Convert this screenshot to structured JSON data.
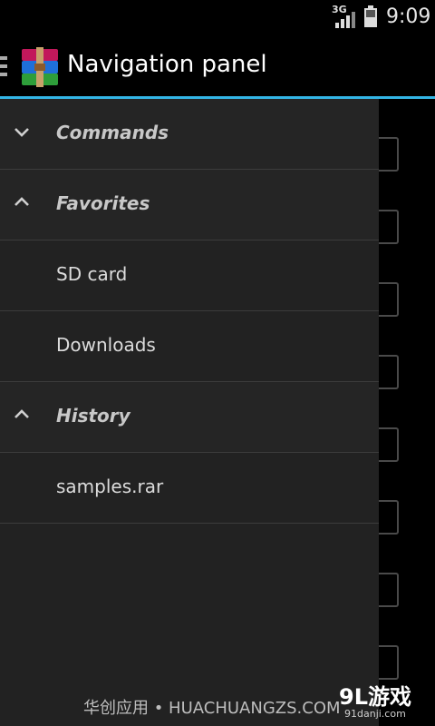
{
  "status": {
    "network": "3G",
    "time": "9:09"
  },
  "action_bar": {
    "title": "Navigation panel"
  },
  "drawer": {
    "rows": [
      {
        "type": "group",
        "label": "Commands",
        "icon": "chevron-down-icon"
      },
      {
        "type": "group",
        "label": "Favorites",
        "icon": "chevron-up-icon"
      },
      {
        "type": "item",
        "label": "SD card"
      },
      {
        "type": "item",
        "label": "Downloads"
      },
      {
        "type": "group",
        "label": "History",
        "icon": "chevron-up-icon"
      },
      {
        "type": "item",
        "label": "samples.rar"
      }
    ]
  },
  "footer": {
    "watermark": "华创应用 • HUACHUANGZS.COM",
    "badge": "9L游戏",
    "badge_site": "91danji.com"
  },
  "colors": {
    "accent": "#33b5e5",
    "drawer_bg": "#222222"
  }
}
